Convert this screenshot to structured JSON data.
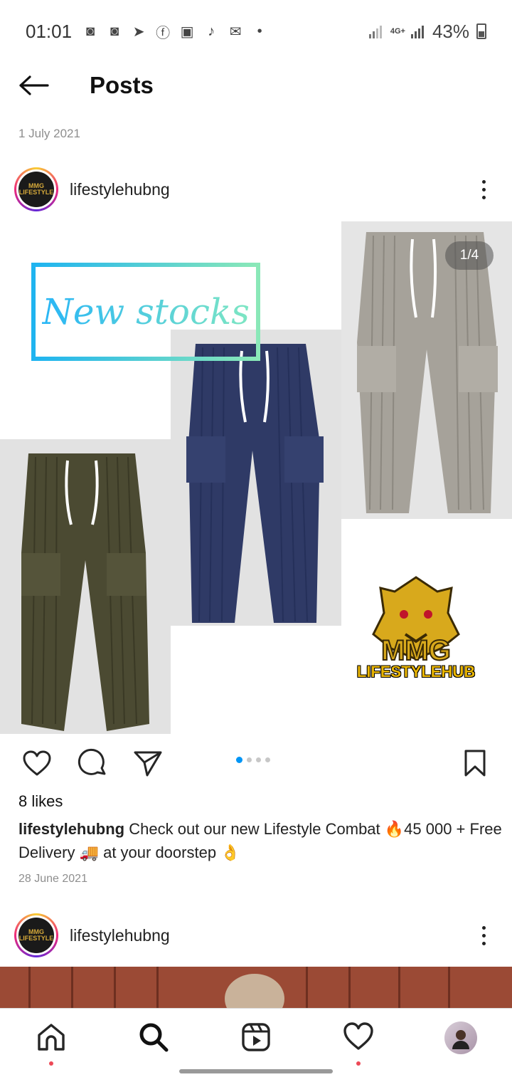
{
  "status_bar": {
    "time": "01:01",
    "network": "4G+",
    "battery": "43%",
    "icons": [
      "discord-icon",
      "discord-icon",
      "telegram-icon",
      "facebook-icon",
      "facebook-icon",
      "music-icon",
      "mail-icon",
      "dot-icon"
    ]
  },
  "header": {
    "title": "Posts"
  },
  "feed": {
    "date_label": "1 July 2021"
  },
  "post": {
    "username": "lifestylehubng",
    "avatar_text": "MMG LIFESTYLE",
    "image": {
      "overlay_text": "New stocks",
      "counter": "1/4",
      "brand_text": "LIFESTYLEHUB",
      "carousel_total": 4,
      "carousel_active": 1
    },
    "likes": "8 likes",
    "caption_user": "lifestylehubng",
    "caption_text": "Check out our new  Lifestyle Combat 🔥45 000 + Free Delivery 🚚 at your doorstep 👌",
    "date": "28 June 2021"
  },
  "next_post": {
    "username": "lifestylehubng",
    "avatar_text": "MMG LIFESTYLE"
  },
  "bottom_nav": {
    "items": [
      "home-icon",
      "search-icon",
      "reels-icon",
      "heart-icon",
      "profile-avatar"
    ]
  },
  "colors": {
    "accent": "#0095f6",
    "notification": "#ed4956",
    "gradient_start": "#29b6f6",
    "gradient_end": "#7ee6c3"
  }
}
